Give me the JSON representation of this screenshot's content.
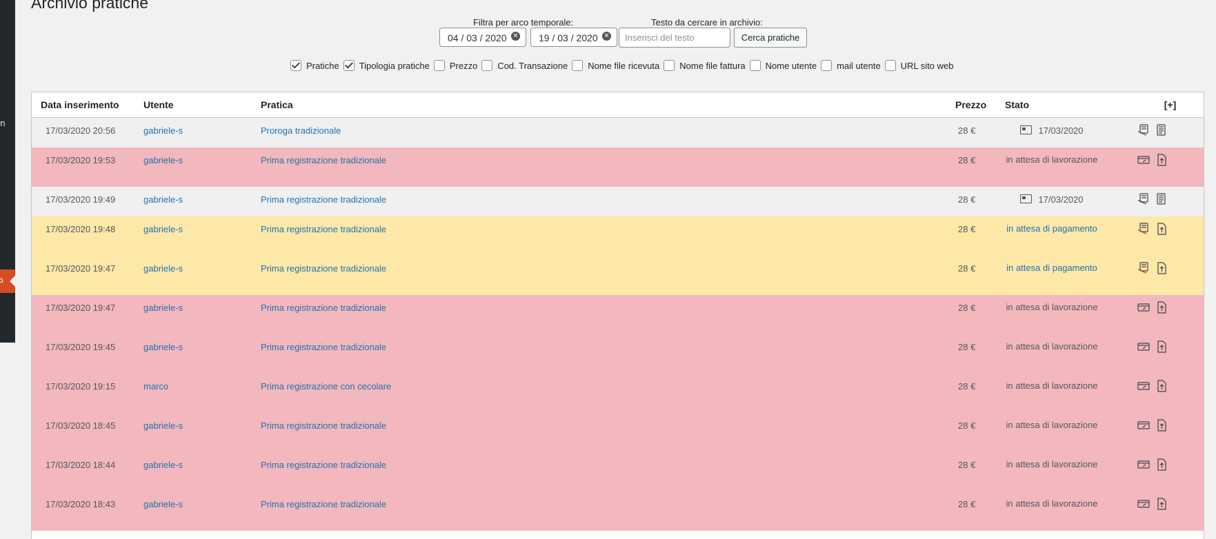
{
  "sidebar": {
    "side_text": "n",
    "active_glyph": "o"
  },
  "page": {
    "title": "Archivio pratiche"
  },
  "filters": {
    "date_label": "Filtra per arco temporale:",
    "text_label": "Testo da cercare in archivio:",
    "date_from": "04 / 03 / 2020",
    "date_to": "19 / 03 / 2020",
    "search_placeholder": "Inserisci del testo",
    "search_button": "Cerca pratiche"
  },
  "columns_toggles": [
    {
      "label": "Pratiche",
      "checked": true
    },
    {
      "label": "Tipologia pratiche",
      "checked": true
    },
    {
      "label": "Prezzo",
      "checked": false
    },
    {
      "label": "Cod. Transazione",
      "checked": false
    },
    {
      "label": "Nome file ricevuta",
      "checked": false
    },
    {
      "label": "Nome file fattura",
      "checked": false
    },
    {
      "label": "Nome utente",
      "checked": false
    },
    {
      "label": "mail utente",
      "checked": false
    },
    {
      "label": "URL sito web",
      "checked": false
    }
  ],
  "table": {
    "headers": {
      "date": "Data inserimento",
      "user": "Utente",
      "pratica": "Pratica",
      "prezzo": "Prezzo",
      "stato": "Stato",
      "actions": "[+]"
    },
    "rows": [
      {
        "date": "17/03/2020 20:56",
        "user": "gabriele-s",
        "pratica": "Proroga tradizionale",
        "prezzo": "28 €",
        "stato": "17/03/2020",
        "status": "done"
      },
      {
        "date": "17/03/2020 19:53",
        "user": "gabriele-s",
        "pratica": "Prima registrazione tradizionale",
        "prezzo": "28 €",
        "stato": "in attesa di lavorazione",
        "status": "work"
      },
      {
        "date": "17/03/2020 19:49",
        "user": "gabriele-s",
        "pratica": "Prima registrazione tradizionale",
        "prezzo": "28 €",
        "stato": "17/03/2020",
        "status": "done"
      },
      {
        "date": "17/03/2020 19:48",
        "user": "gabriele-s",
        "pratica": "Prima registrazione tradizionale",
        "prezzo": "28 €",
        "stato": "in attesa di pagamento",
        "status": "pay"
      },
      {
        "date": "17/03/2020 19:47",
        "user": "gabriele-s",
        "pratica": "Prima registrazione tradizionale",
        "prezzo": "28 €",
        "stato": "in attesa di pagamento",
        "status": "pay"
      },
      {
        "date": "17/03/2020 19:47",
        "user": "gabriele-s",
        "pratica": "Prima registrazione tradizionale",
        "prezzo": "28 €",
        "stato": "in attesa di lavorazione",
        "status": "work"
      },
      {
        "date": "17/03/2020 19:45",
        "user": "gabriele-s",
        "pratica": "Prima registrazione tradizionale",
        "prezzo": "28 €",
        "stato": "in attesa di lavorazione",
        "status": "work"
      },
      {
        "date": "17/03/2020 19:15",
        "user": "marco",
        "pratica": "Prima registrazione con cecolare",
        "prezzo": "28 €",
        "stato": "in attesa di lavorazione",
        "status": "work"
      },
      {
        "date": "17/03/2020 18:45",
        "user": "gabriele-s",
        "pratica": "Prima registrazione tradizionale",
        "prezzo": "28 €",
        "stato": "in attesa di lavorazione",
        "status": "work"
      },
      {
        "date": "17/03/2020 18:44",
        "user": "gabriele-s",
        "pratica": "Prima registrazione tradizionale",
        "prezzo": "28 €",
        "stato": "in attesa di lavorazione",
        "status": "work"
      },
      {
        "date": "17/03/2020 18:43",
        "user": "gabriele-s",
        "pratica": "Prima registrazione tradizionale",
        "prezzo": "28 €",
        "stato": "in attesa di lavorazione",
        "status": "work"
      }
    ]
  },
  "colors": {
    "row_done": "#f0f0f1",
    "row_work": "#f2b8bd",
    "row_pay": "#fee8a8",
    "link": "#2271b1",
    "accent": "#d54e21"
  }
}
